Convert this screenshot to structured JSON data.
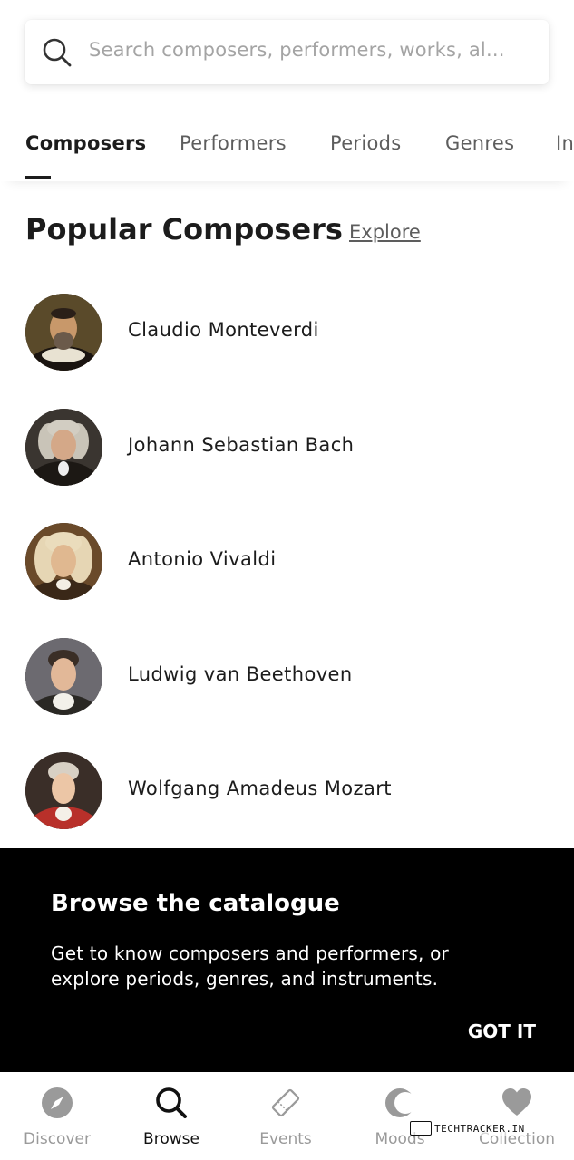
{
  "search": {
    "placeholder": "Search composers, performers, works, al..."
  },
  "tabs": [
    {
      "label": "Composers",
      "active": true
    },
    {
      "label": "Performers",
      "active": false
    },
    {
      "label": "Periods",
      "active": false
    },
    {
      "label": "Genres",
      "active": false
    },
    {
      "label": "In",
      "active": false
    }
  ],
  "section": {
    "title": "Popular Composers",
    "explore_label": "Explore"
  },
  "composers": [
    {
      "name": "Claudio Monteverdi",
      "avatar": "portrait-monteverdi"
    },
    {
      "name": "Johann Sebastian Bach",
      "avatar": "portrait-bach"
    },
    {
      "name": "Antonio Vivaldi",
      "avatar": "portrait-vivaldi"
    },
    {
      "name": "Ludwig van Beethoven",
      "avatar": "portrait-beethoven"
    },
    {
      "name": "Wolfgang Amadeus Mozart",
      "avatar": "portrait-mozart"
    }
  ],
  "tooltip": {
    "title": "Browse the catalogue",
    "body": "Get to know composers and performers, or explore periods, genres, and instruments.",
    "dismiss_label": "GOT IT"
  },
  "bottom_nav": [
    {
      "label": "Discover",
      "icon": "compass-icon",
      "active": false
    },
    {
      "label": "Browse",
      "icon": "search-icon",
      "active": true
    },
    {
      "label": "Events",
      "icon": "ticket-icon",
      "active": false
    },
    {
      "label": "Moods",
      "icon": "moon-icon",
      "active": false
    },
    {
      "label": "Collection",
      "icon": "heart-icon",
      "active": false
    }
  ],
  "watermark": {
    "text": "TechTracker.in"
  },
  "colors": {
    "text_primary": "#1c1c1c",
    "text_secondary": "#5d5d5d",
    "nav_inactive": "#9a9a9a",
    "tooltip_bg": "#000000"
  }
}
